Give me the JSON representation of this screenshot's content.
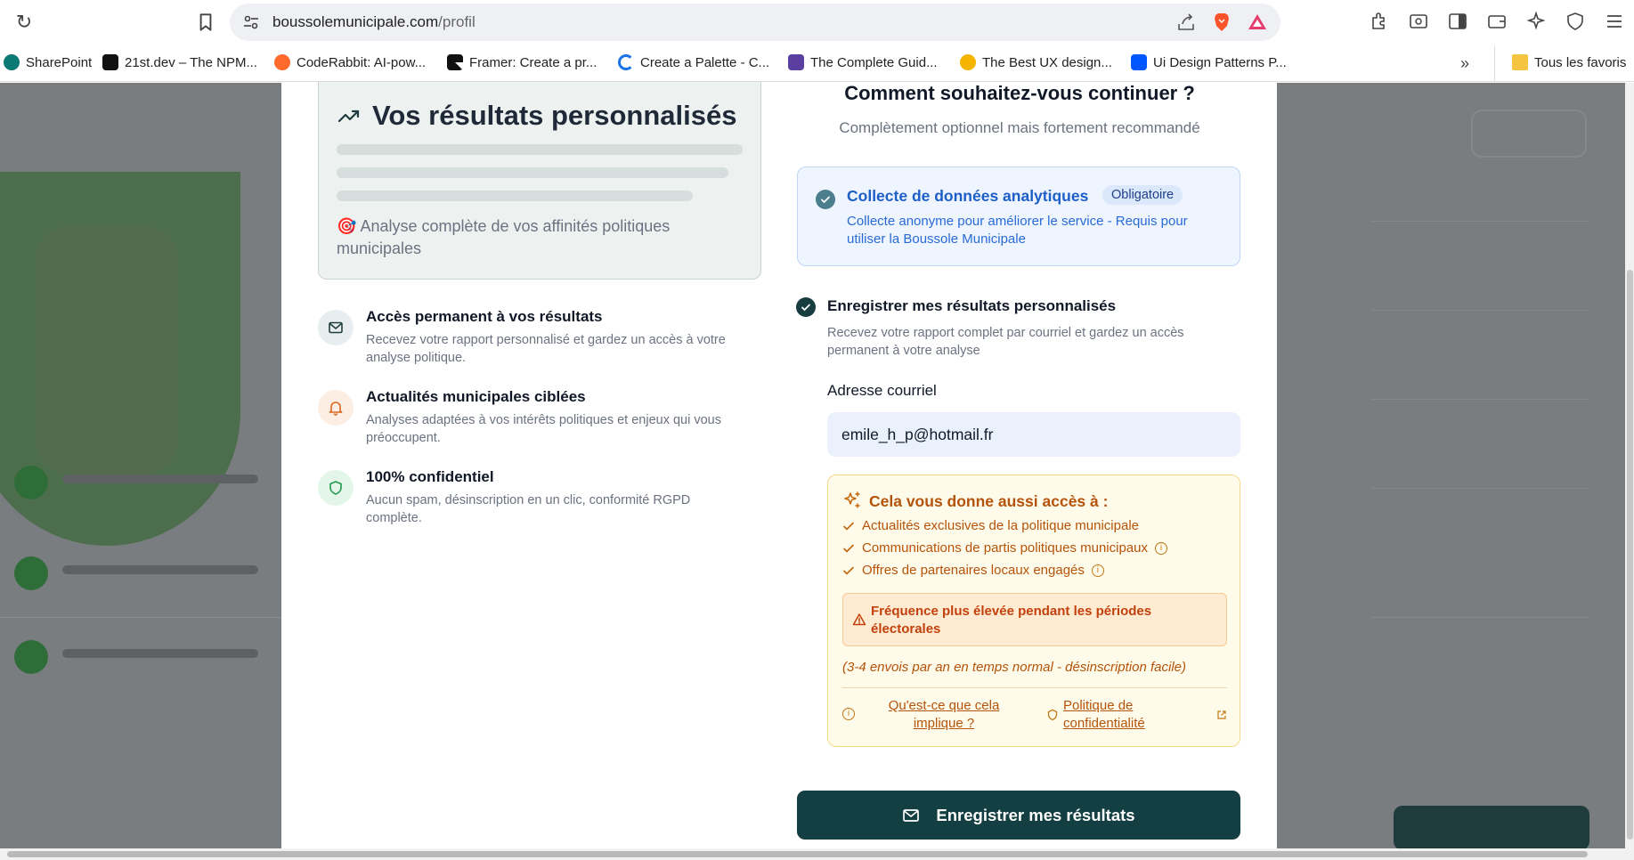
{
  "browser": {
    "url_domain": "boussolemunicipale.com",
    "url_path": "/profil",
    "bookmarks": [
      {
        "label": "SharePoint",
        "color": "#0b7a75"
      },
      {
        "label": "21st.dev – The NPM...",
        "color": "#111111"
      },
      {
        "label": "CodeRabbit: AI-pow...",
        "color": "#ff6a2c"
      },
      {
        "label": "Framer: Create a pr...",
        "color": "#111111"
      },
      {
        "label": "Create a Palette - C...",
        "color": "#1a73e8"
      },
      {
        "label": "The Complete Guid...",
        "color": "#5a3fa0"
      },
      {
        "label": "The Best UX design...",
        "color": "#f4b400"
      },
      {
        "label": "Ui Design Patterns P...",
        "color": "#0057ff"
      }
    ],
    "bookmarks_all_label": "Tous les favoris"
  },
  "left": {
    "result_title": "Vos résultats personnalisés",
    "result_desc_emoji": "🎯",
    "result_desc": "Analyse complète de vos affinités politiques municipales",
    "features": [
      {
        "title": "Accès permanent à vos résultats",
        "desc": "Recevez votre rapport personnalisé et gardez un accès à votre analyse politique.",
        "icon": "mail-icon",
        "bg": "#e8eef0",
        "color": "#1f3c3f"
      },
      {
        "title": "Actualités municipales ciblées",
        "desc": "Analyses adaptées à vos intérêts politiques et enjeux qui vous préoccupent.",
        "icon": "bell-icon",
        "bg": "#fdeee4",
        "color": "#d9661e"
      },
      {
        "title": "100% confidentiel",
        "desc": "Aucun spam, désinscription en un clic, conformité RGPD complète.",
        "icon": "shield-icon",
        "bg": "#e4f6ea",
        "color": "#1f9a4e"
      }
    ]
  },
  "right": {
    "question": "Comment souhaitez-vous continuer ?",
    "subtitle": "Complètement optionnel mais fortement recommandé",
    "analytics": {
      "title": "Collecte de données analytiques",
      "badge": "Obligatoire",
      "desc": "Collecte anonyme pour améliorer le service - Requis pour utiliser la Boussole Municipale"
    },
    "save": {
      "title": "Enregistrer mes résultats personnalisés",
      "desc": "Recevez votre rapport complet par courriel et gardez un accès permanent à votre analyse"
    },
    "email_label": "Adresse courriel",
    "email_value": "emile_h_p@hotmail.fr",
    "perks": {
      "title": "Cela vous donne aussi accès à :",
      "items": [
        "Actualités exclusives de la politique municipale",
        "Communications de partis politiques municipaux",
        "Offres de partenaires locaux engagés"
      ],
      "warning": "Fréquence plus élevée pendant les périodes électorales",
      "frequency_note": "(3-4 envois par an en temps normal - désinscription facile)",
      "link_implications": "Qu'est-ce que cela implique ?",
      "link_privacy": "Politique de confidentialité"
    },
    "submit_label": "Enregistrer mes résultats"
  },
  "colors": {
    "brand_dark": "#143f42",
    "analytics_blue": "#1e5fc7",
    "perk_orange": "#b4530a"
  }
}
